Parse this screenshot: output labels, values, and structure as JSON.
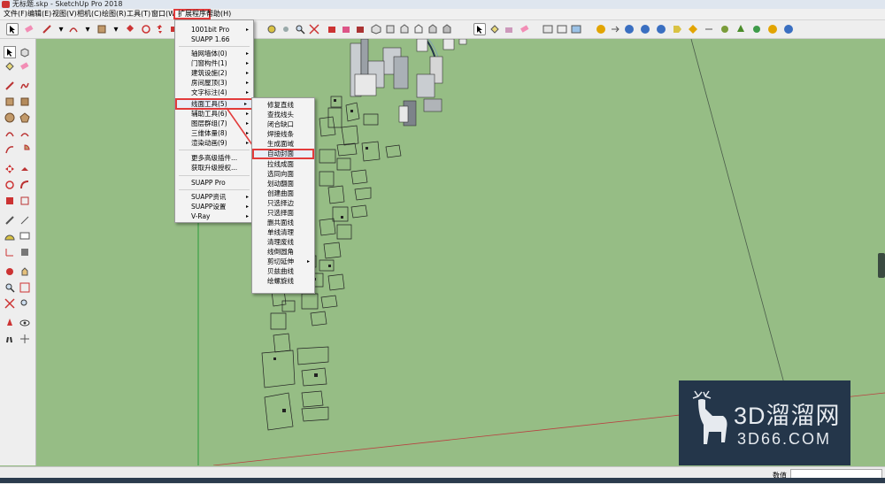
{
  "window": {
    "title": "无标题.skp - SketchUp Pro 2018"
  },
  "menubar": {
    "items": [
      {
        "id": "file",
        "label": "文件(F)"
      },
      {
        "id": "edit",
        "label": "编辑(E)"
      },
      {
        "id": "view",
        "label": "视图(V)"
      },
      {
        "id": "camera",
        "label": "相机(C)"
      },
      {
        "id": "draw",
        "label": "绘图(R)"
      },
      {
        "id": "tools",
        "label": "工具(T)"
      },
      {
        "id": "window",
        "label": "窗口(W)"
      },
      {
        "id": "extensions",
        "label": "扩展程序"
      },
      {
        "id": "help",
        "label": "帮助(H)"
      }
    ]
  },
  "dropdown": {
    "items": [
      {
        "label": "1001bit Pro",
        "arrow": "▸"
      },
      {
        "label": "SUAPP 1.66",
        "arrow": ""
      },
      {
        "label": "轴网墙体(0)",
        "arrow": "▸"
      },
      {
        "label": "门窗构件(1)",
        "arrow": "▸"
      },
      {
        "label": "建筑设施(2)",
        "arrow": "▸"
      },
      {
        "label": "房间屋顶(3)",
        "arrow": "▸"
      },
      {
        "label": "文字标注(4)",
        "arrow": "▸"
      },
      {
        "label": "线面工具(5)",
        "arrow": "▸"
      },
      {
        "label": "辅助工具(6)",
        "arrow": "▸"
      },
      {
        "label": "图层群组(7)",
        "arrow": "▸"
      },
      {
        "label": "三维体量(8)",
        "arrow": "▸"
      },
      {
        "label": "渲染动画(9)",
        "arrow": "▸"
      },
      {
        "label": "更多高级插件...",
        "arrow": ""
      },
      {
        "label": "获取升级授权...",
        "arrow": ""
      },
      {
        "label": "SUAPP Pro",
        "arrow": ""
      },
      {
        "label": "SUAPP资讯",
        "arrow": "▸"
      },
      {
        "label": "SUAPP设置",
        "arrow": "▸"
      },
      {
        "label": "V-Ray",
        "arrow": "▸"
      }
    ]
  },
  "submenu": {
    "items": [
      {
        "label": "修复直线",
        "arrow": ""
      },
      {
        "label": "查找线头",
        "arrow": ""
      },
      {
        "label": "闭合缺口",
        "arrow": ""
      },
      {
        "label": "焊接线条",
        "arrow": ""
      },
      {
        "label": "生成面域",
        "arrow": ""
      },
      {
        "label": "自动封面",
        "arrow": ""
      },
      {
        "label": "拉线成面",
        "arrow": ""
      },
      {
        "label": "选同向面",
        "arrow": ""
      },
      {
        "label": "划动翻面",
        "arrow": ""
      },
      {
        "label": "创建曲面",
        "arrow": ""
      },
      {
        "label": "只选择边",
        "arrow": ""
      },
      {
        "label": "只选择面",
        "arrow": ""
      },
      {
        "label": "删共面线",
        "arrow": ""
      },
      {
        "label": "单线清理",
        "arrow": ""
      },
      {
        "label": "清理废线",
        "arrow": ""
      },
      {
        "label": "线倒圆角",
        "arrow": ""
      },
      {
        "label": "剪切延伸",
        "arrow": "▸"
      },
      {
        "label": "贝兹曲线",
        "arrow": ""
      },
      {
        "label": "绘螺旋线",
        "arrow": ""
      }
    ]
  },
  "statusbar": {
    "measure_label": "数值",
    "measure_value": ""
  },
  "watermark": {
    "line1": "3D溜溜网",
    "line2": "3D66.COM"
  },
  "colors": {
    "viewport_bg": "#96bd85",
    "highlight_border": "#e23b3b",
    "watermark_bg": "#24364a"
  }
}
